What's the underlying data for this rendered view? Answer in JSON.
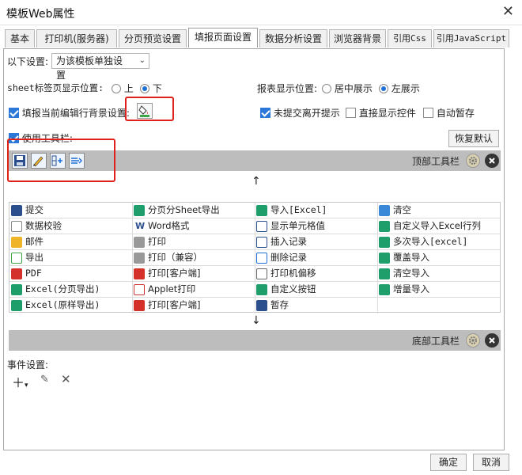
{
  "window": {
    "title": "模板Web属性"
  },
  "tabs": [
    {
      "label": "基本",
      "active": false
    },
    {
      "label": "打印机(服务器)",
      "active": false
    },
    {
      "label": "分页预览设置",
      "active": false
    },
    {
      "label": "填报页面设置",
      "active": true
    },
    {
      "label": "数据分析设置",
      "active": false
    },
    {
      "label": "浏览器背景",
      "active": false
    },
    {
      "label": "引用Css",
      "active": false
    },
    {
      "label": "引用JavaScript",
      "active": false
    }
  ],
  "settings": {
    "scope_label": "以下设置:",
    "scope_value": "为该模板单独设置",
    "sheet_pos_label": "sheet标签页显示位置:",
    "sheet_pos_options": [
      "上",
      "下"
    ],
    "sheet_pos_selected": "下",
    "report_pos_label": "报表显示位置:",
    "report_pos_options": [
      "居中展示",
      "左展示"
    ],
    "report_pos_selected": "左展示",
    "fill_bg_label": "填报当前编辑行背景设置:",
    "fill_bg_checked": true,
    "unsubmitted_label": "未提交离开提示",
    "unsubmitted_checked": true,
    "direct_show_label": "直接显示控件",
    "direct_show_checked": false,
    "autosave_label": "自动暂存",
    "autosave_checked": false,
    "use_toolbar_label": "使用工具栏:",
    "use_toolbar_checked": true,
    "restore_default": "恢复默认"
  },
  "toolbar": {
    "top_label": "顶部工具栏",
    "bottom_label": "底部工具栏",
    "icons": [
      "save-icon",
      "edit-icon",
      "insert-row-icon",
      "delete-row-icon"
    ]
  },
  "buttons_grid": [
    [
      "提交",
      "分页分Sheet导出",
      "导入[Excel]",
      "清空"
    ],
    [
      "数据校验",
      "Word格式",
      "显示单元格值",
      "自定义导入Excel行列"
    ],
    [
      "邮件",
      "打印",
      "插入记录",
      "多次导入[excel]"
    ],
    [
      "导出",
      "打印（兼容）",
      "删除记录",
      "覆盖导入"
    ],
    [
      "PDF",
      "打印[客户端]",
      "打印机偏移",
      "清空导入"
    ],
    [
      "Excel(分页导出)",
      "Applet打印",
      "自定义按钮",
      "增量导入"
    ],
    [
      "Excel(原样导出)",
      "打印[客户端]",
      "暂存",
      ""
    ]
  ],
  "events": {
    "label": "事件设置:"
  },
  "footer": {
    "ok": "确定",
    "cancel": "取消"
  },
  "colors": {
    "accent": "#2b78d8",
    "highlight": "#e0201a",
    "toolbar_band": "#bdbdbd"
  }
}
